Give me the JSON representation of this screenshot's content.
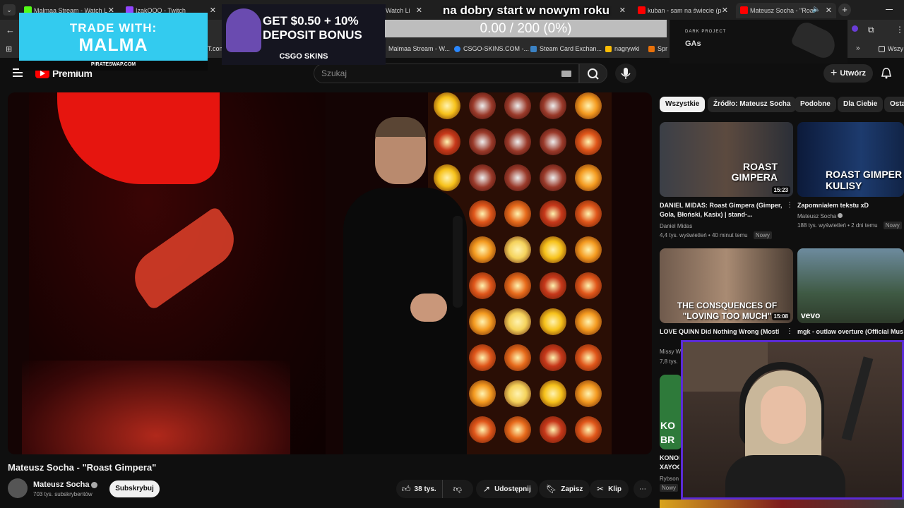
{
  "browser": {
    "tabs": [
      {
        "label": "Malmaa Stream - Watch L",
        "fav_color": "#53fc18"
      },
      {
        "label": "IzakOOO - Twitch",
        "fav_color": "#9146ff"
      },
      {
        "label": "Watch Li",
        "fav_color": "#53fc18"
      },
      {
        "label": "kuban - sam na świecie (p",
        "fav_color": "#ff0000"
      },
      {
        "label": "Mateusz Socha - \"Roa",
        "fav_color": "#ff0000"
      }
    ],
    "bookmarks": [
      {
        "label": "Malmaa Stream - W...",
        "color": "#53fc18"
      },
      {
        "label": "CSGO-SKINS.COM -...",
        "color": "#2b88ff"
      },
      {
        "label": "Steam Card Exchan...",
        "color": "#3b82c4"
      },
      {
        "label": "nagrywki",
        "color": "#fbbc05"
      },
      {
        "label": "Spr",
        "color": "#e8710a"
      },
      {
        "label": "Wszy",
        "color": "#888888"
      }
    ],
    "bookmark_partial": "T.com"
  },
  "overlays": {
    "goal_title": "na dobry start w nowym roku",
    "goal_progress": "0.00 / 200 (0%)",
    "malma_line1": "TRADE WITH:",
    "malma_line2": "MALMA",
    "malma_site": "PIRATESWAP.COM",
    "csgo_line1": "GET $0.50 + 10%",
    "csgo_line2": "DEPOSIT BONUS",
    "csgo_brand": "CSGO SKINS",
    "darkproject_small": "DARK PROJECT",
    "darkproject_text": "GAs"
  },
  "youtube": {
    "logo_label": "Premium",
    "search_placeholder": "Szukaj",
    "create_label": "Utwórz",
    "video": {
      "title": "Mateusz Socha - \"Roast Gimpera\"",
      "channel": "Mateusz Socha",
      "subscribers": "703 tys. subskrybentów",
      "subscribe_label": "Subskrybuj",
      "likes": "38 tys.",
      "share_label": "Udostępnij",
      "save_label": "Zapisz",
      "clip_label": "Klip"
    },
    "chips": [
      "Wszystkie",
      "Źródło: Mateusz Socha",
      "Podobne",
      "Dla Ciebie",
      "Osta"
    ],
    "recommendations": [
      {
        "title": "DANIEL MIDAS: Roast Gimpera (Gimper, Gola, Błoński, Kasix) | stand-...",
        "channel": "Daniel Midas",
        "meta": "4,4 tys. wyświetleń • 40 minut temu",
        "badge": "Nowy",
        "duration": "15:23",
        "thumb_text": "ROAST GIMPERA"
      },
      {
        "title": "Zapomniałem tekstu xD",
        "channel": "Mateusz Socha",
        "meta": "188 tys. wyświetleń • 2 dni temu",
        "badge": "Nowy",
        "duration": "",
        "thumb_text": "ROAST GIMPER KULISY"
      },
      {
        "title": "LOVE QUINN Did Nothing Wrong (Mostl",
        "channel": "Missy W",
        "meta": "7,8 tys.",
        "badge": "",
        "duration": "15:08",
        "thumb_text": "THE CONSQUENCES OF \"LOVING TOO MUCH\""
      },
      {
        "title": "mgk - outlaw overture (Official Mus",
        "channel": "",
        "meta": "",
        "badge": "",
        "duration": "",
        "thumb_text": "vevo"
      },
      {
        "title": "KONOF XAYOC",
        "channel": "Rybson",
        "meta": "",
        "badge": "Nowy",
        "duration": "",
        "thumb_text": "KO BR"
      }
    ]
  }
}
